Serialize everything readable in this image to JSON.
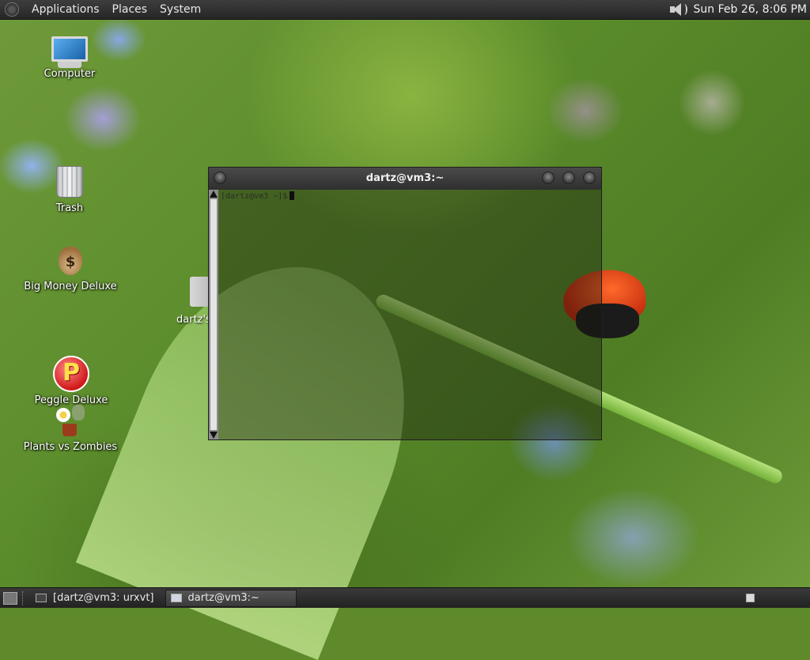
{
  "top_panel": {
    "menus": [
      "Applications",
      "Places",
      "System"
    ],
    "clock": "Sun Feb 26,  8:06 PM"
  },
  "desktop_icons": {
    "computer": "Computer",
    "trash": "Trash",
    "big_money": "Big Money Deluxe",
    "peggle": "Peggle Deluxe",
    "pvz": "Plants vs Zombies",
    "home_folder": "dartz's"
  },
  "terminal": {
    "title": "dartz@vm3:~",
    "prompt": "[dartz@vm3 ~]$"
  },
  "taskbar": {
    "tasks": [
      "[dartz@vm3: urxvt]",
      "dartz@vm3:~"
    ]
  }
}
